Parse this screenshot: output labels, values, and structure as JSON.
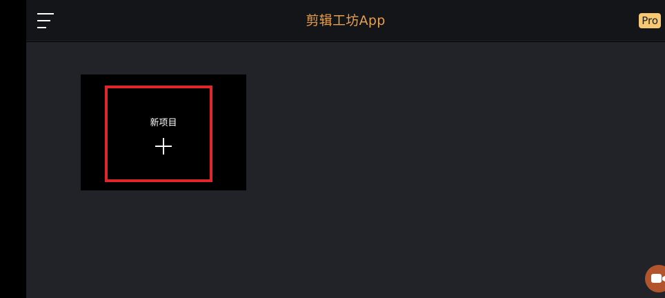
{
  "header": {
    "title": "剪辑工坊App",
    "pro_label": "Pro",
    "menu_icon": "menu-icon"
  },
  "main": {
    "new_project": {
      "label": "新项目",
      "icon": "plus-icon"
    }
  },
  "floating_button": {
    "icon": "video-camera-icon"
  },
  "colors": {
    "accent": "#e8a04c",
    "pro_badge": "#f6c871",
    "highlight": "#e0262b",
    "background": "#222328",
    "header": "#141519",
    "floating_button": "#b3552c"
  }
}
